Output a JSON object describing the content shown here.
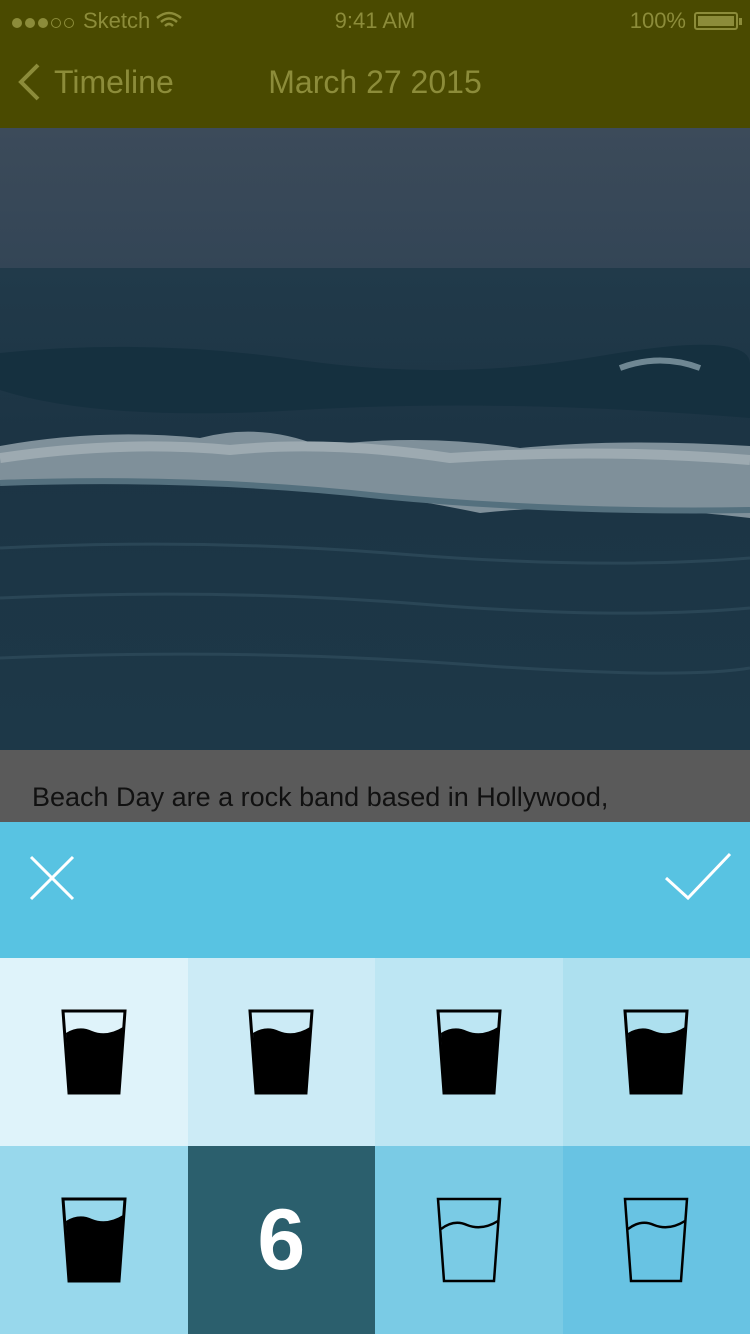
{
  "status_bar": {
    "carrier": "Sketch",
    "time": "9:41 AM",
    "battery": "100%"
  },
  "nav": {
    "back_label": "Timeline",
    "title": "March 27 2015"
  },
  "caption": {
    "text": "Beach Day are a rock band based in Hollywood,"
  },
  "picker": {
    "colors": {
      "header": "#58c3e2",
      "selected": "#2b5f6d"
    },
    "cells": [
      {
        "type": "full-glass",
        "bg": "#dff3fa"
      },
      {
        "type": "full-glass",
        "bg": "#ccebf6"
      },
      {
        "type": "full-glass",
        "bg": "#bde6f3"
      },
      {
        "type": "full-glass",
        "bg": "#ade0ef"
      },
      {
        "type": "full-glass",
        "bg": "#98d8ec"
      },
      {
        "type": "selected-number",
        "label": "6",
        "bg": "#2b5f6d"
      },
      {
        "type": "empty-glass",
        "bg": "#7acbe5"
      },
      {
        "type": "empty-glass",
        "bg": "#68c3e3"
      }
    ]
  }
}
